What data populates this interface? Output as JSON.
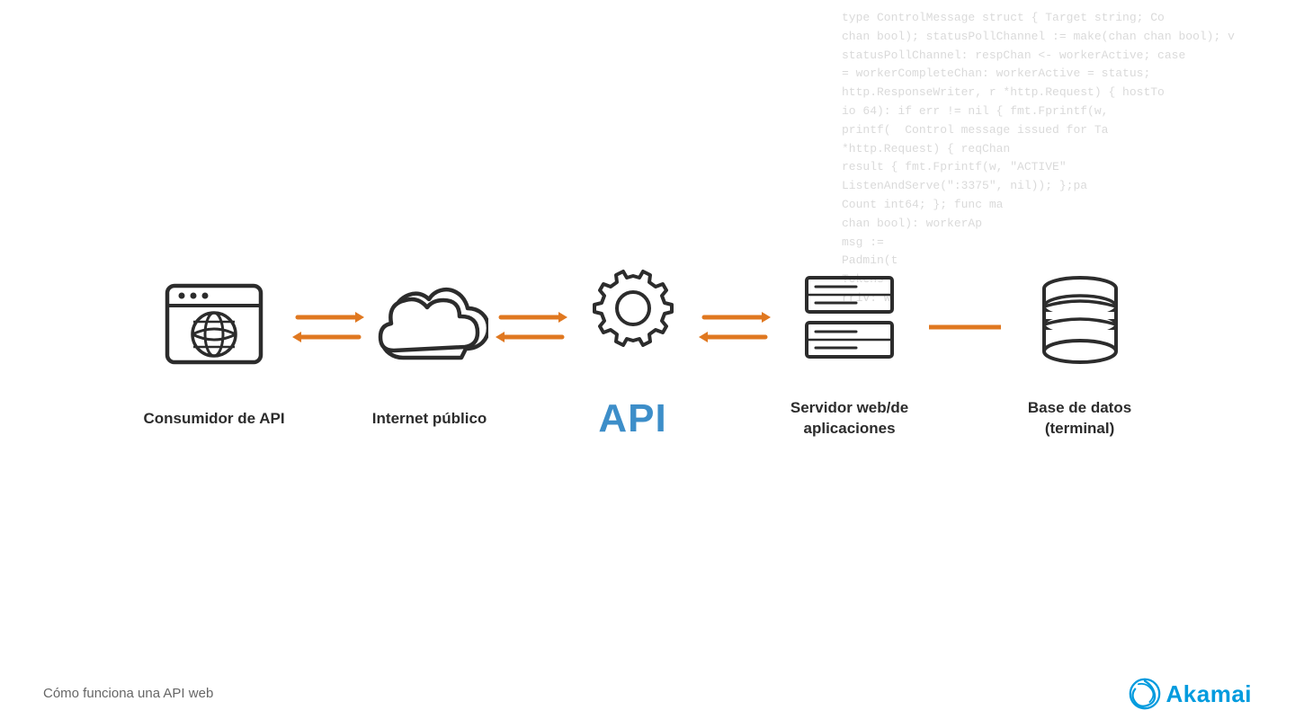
{
  "code_bg": {
    "lines": [
      "type ControlMessage struct { Target string; Co",
      "chan bool); statusPollChannel := make(chan chan bool); v",
      "statusPollChannel: respChan <- workerActive; case",
      "= workerCompleteChan: workerActive = status;",
      "http.ResponseWriter, r *http.Request) { hostTo",
      "io 64): if err != nil { fmt.Fprintf(w,",
      "printf(  Control message issued for Ta",
      "*http.Request) { reqChan",
      "result { fmt.Fprintf(w, \"ACTIVE\"",
      "ListenAndServe(\":3375\", nil)); };pa",
      "Count int64; }; func ma",
      "chan bool): workerAp",
      "msg :=",
      "Padmin(t",
      "Tokens",
      "rriv: w"
    ]
  },
  "diagram": {
    "items": [
      {
        "id": "consumer",
        "label": "Consumidor de API",
        "type": "browser"
      },
      {
        "id": "internet",
        "label": "Internet público",
        "type": "cloud"
      },
      {
        "id": "api",
        "label": "API",
        "type": "gear"
      },
      {
        "id": "server",
        "label": "Servidor web/de aplicaciones",
        "type": "server"
      },
      {
        "id": "database",
        "label": "Base de datos (terminal)",
        "type": "database"
      }
    ],
    "arrows": [
      {
        "id": "arr1",
        "type": "double"
      },
      {
        "id": "arr2",
        "type": "double"
      },
      {
        "id": "arr3",
        "type": "double"
      },
      {
        "id": "arr4",
        "type": "single"
      }
    ]
  },
  "caption": "Cómo funciona una API web",
  "brand": {
    "name": "Akamai",
    "color": "#009bde"
  }
}
